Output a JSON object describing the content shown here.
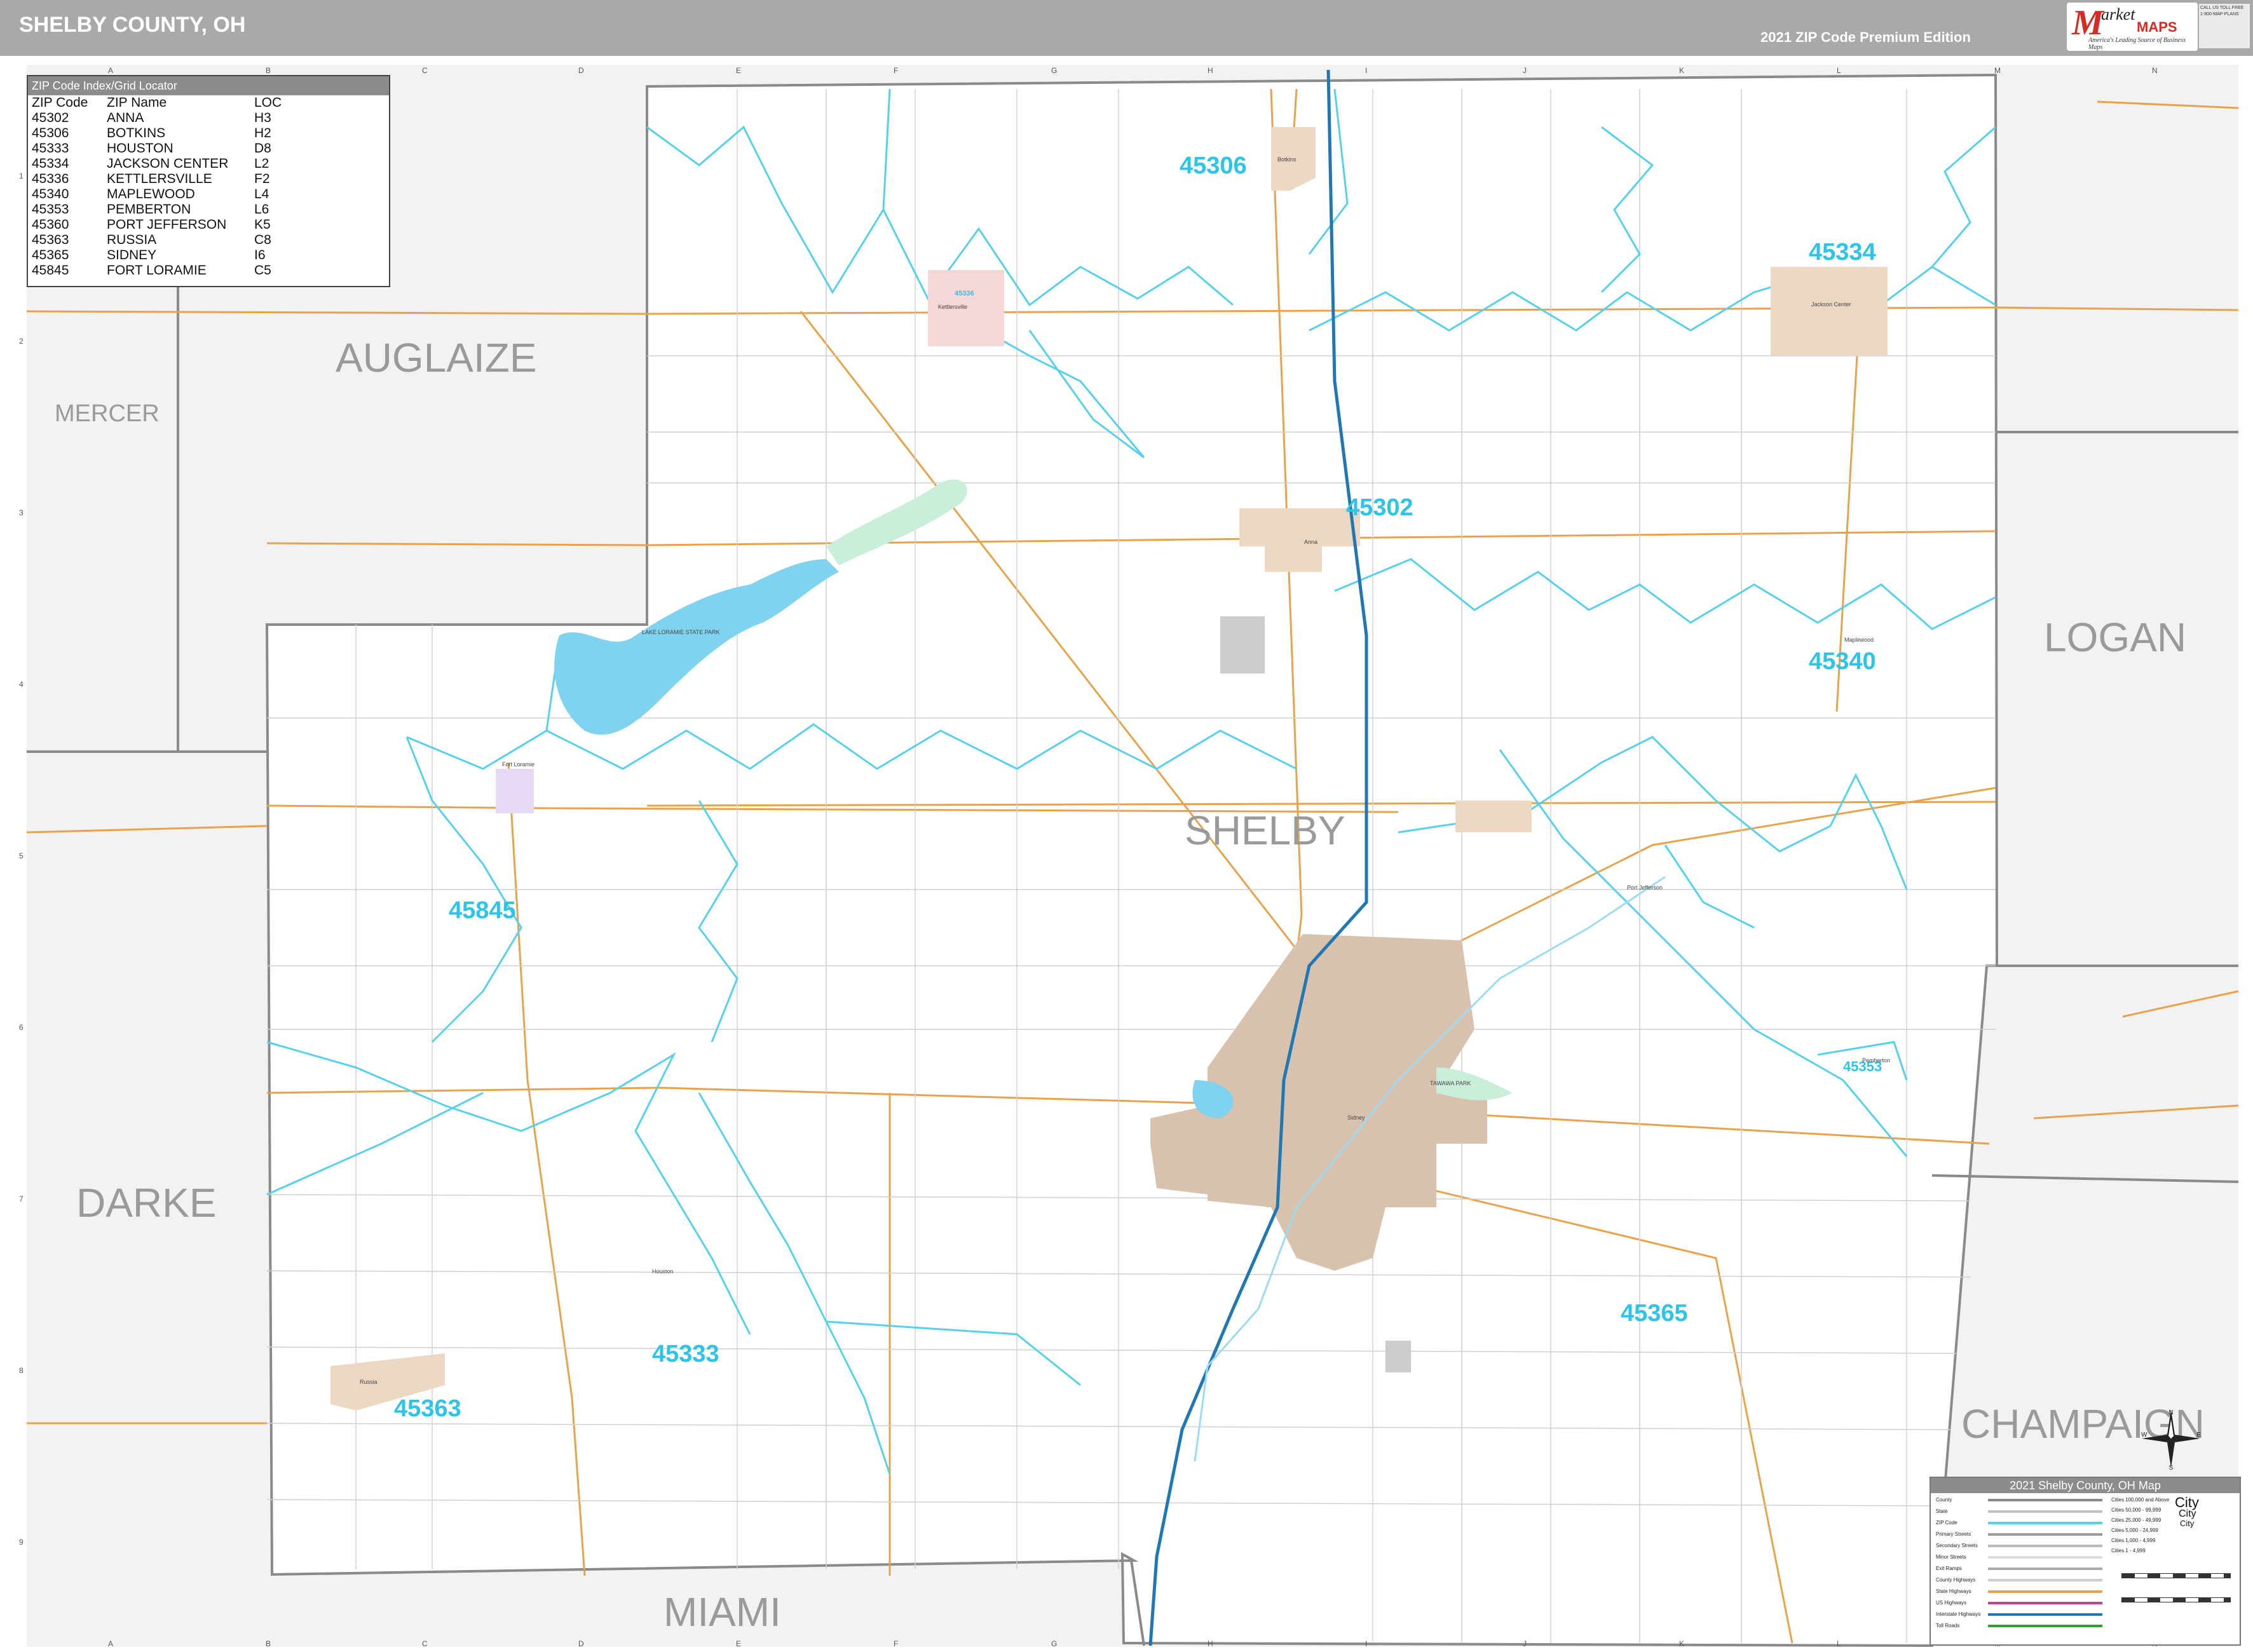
{
  "header": {
    "title": "SHELBY COUNTY, OH",
    "edition": "2021 ZIP Code Premium Edition",
    "logo": {
      "m": "M",
      "arket": "arket",
      "maps": "MAPS",
      "slogan": "America's Leading Source of Business Maps",
      "contact": "CALL US TOLL FREE 1-800-MAP-PLANS"
    }
  },
  "grid": {
    "columns": [
      "A",
      "B",
      "C",
      "D",
      "E",
      "F",
      "G",
      "H",
      "I",
      "J",
      "K",
      "L",
      "M",
      "N"
    ],
    "rows": [
      "1",
      "2",
      "3",
      "4",
      "5",
      "6",
      "7",
      "8",
      "9"
    ]
  },
  "zip_index": {
    "header": "ZIP Code Index/Grid Locator",
    "columns": [
      "ZIP Code",
      "ZIP Name",
      "LOC"
    ],
    "rows": [
      [
        "45302",
        "ANNA",
        "H3"
      ],
      [
        "45306",
        "BOTKINS",
        "H2"
      ],
      [
        "45333",
        "HOUSTON",
        "D8"
      ],
      [
        "45334",
        "JACKSON CENTER",
        "L2"
      ],
      [
        "45336",
        "KETTLERSVILLE",
        "F2"
      ],
      [
        "45340",
        "MAPLEWOOD",
        "L4"
      ],
      [
        "45353",
        "PEMBERTON",
        "L6"
      ],
      [
        "45360",
        "PORT JEFFERSON",
        "K5"
      ],
      [
        "45363",
        "RUSSIA",
        "C8"
      ],
      [
        "45365",
        "SIDNEY",
        "I6"
      ],
      [
        "45845",
        "FORT LORAMIE",
        "C5"
      ]
    ]
  },
  "counties": {
    "auglaize": "AUGLAIZE",
    "mercer": "MERCER",
    "logan": "LOGAN",
    "darke": "DARKE",
    "miami": "MIAMI",
    "champaign": "CHAMPAIGN",
    "shelby": "SHELBY"
  },
  "zip_labels": {
    "z45306": "45306",
    "z45334": "45334",
    "z45302": "45302",
    "z45340": "45340",
    "z45845": "45845",
    "z45353": "45353",
    "z45365": "45365",
    "z45333": "45333",
    "z45363": "45363",
    "z45336": "45336"
  },
  "towns": {
    "lake_loramie": "LAKE LORAMIE STATE PARK",
    "tawawa": "TAWAWA PARK",
    "fort_loramie": "Fort Loramie",
    "sidney": "Sidney",
    "anna": "Anna",
    "botkins": "Botkins",
    "jackson_center": "Jackson Center",
    "port_jefferson": "Port Jefferson",
    "russia": "Russia",
    "houston": "Houston",
    "kettlersville": "Kettlersville",
    "maplewood": "Maplewood",
    "pemberton": "Pemberton"
  },
  "legend": {
    "title": "2021 Shelby County, OH Map",
    "items": [
      "County",
      "State",
      "ZIP Code",
      "Primary Streets",
      "Secondary Streets",
      "Minor Streets",
      "Exit Ramps",
      "County Highways",
      "State Highways",
      "US Highways",
      "Interstate Highways",
      "Toll Roads"
    ],
    "cities": [
      "Cities 100,000 and Above",
      "Cities 50,000 - 99,999",
      "Cities 25,000 - 49,999",
      "Cities 5,000 - 24,999",
      "Cities 1,000 - 4,999",
      "Cities 1 - 4,999"
    ],
    "city_word": "City"
  },
  "compass": {
    "n": "N",
    "s": "S",
    "e": "E",
    "w": "W"
  },
  "colors": {
    "zip_label": "#2ec3e8",
    "zip_boundary": "#56d0ec",
    "county_line": "#8a8a8a",
    "outside_fill": "#f2f2f2",
    "urban_fill": "#d8c2ae",
    "water": "#7fd3ef",
    "interstate": "#1f78b4",
    "state_hwy": "#e8a24a"
  }
}
